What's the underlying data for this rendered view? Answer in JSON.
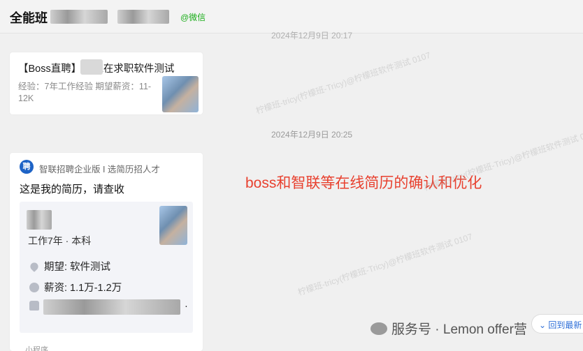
{
  "header": {
    "title": "全能班",
    "wechat_tag": "@微信"
  },
  "chat": {
    "faint_timestamp": "2024年12月9日 20:17",
    "timestamp": "2024年12月9日 20:25",
    "boss_card": {
      "title_prefix": "【Boss直聘】",
      "title_suffix": "E在求职软件测试",
      "meta": "经验：7年工作经验    期望薪资：11-12K"
    },
    "zhilian_card": {
      "app_icon_text": "聘",
      "app_name": "智联招聘企业版 I 选简历招人才",
      "message": "这是我的简历，请查收",
      "experience": "工作7年  ·  本科",
      "expectation": "期望: 软件测试",
      "salary": "薪资: 1.1万-1.2万",
      "contact_tail": "·",
      "footer_label": "小程序"
    }
  },
  "annotation": "boss和智联等在线简历的确认和优化",
  "watermarks": [
    "柠檬班-tricy(柠檬班-Tricy)@柠檬班软件测试 0107",
    "柠檬班-tricy(柠檬班-Tricy)@柠檬班软件测试 0107",
    "柠檬班-tricy(柠檬班-Tricy)@柠檬班软件测试 0107"
  ],
  "footer": {
    "brand": "服务号 · Lemon offer营",
    "back_to_latest": "回到最新"
  },
  "colors": {
    "annotation": "#e8412f",
    "wechat_tag": "#1aad19",
    "link": "#2f6fd8"
  }
}
